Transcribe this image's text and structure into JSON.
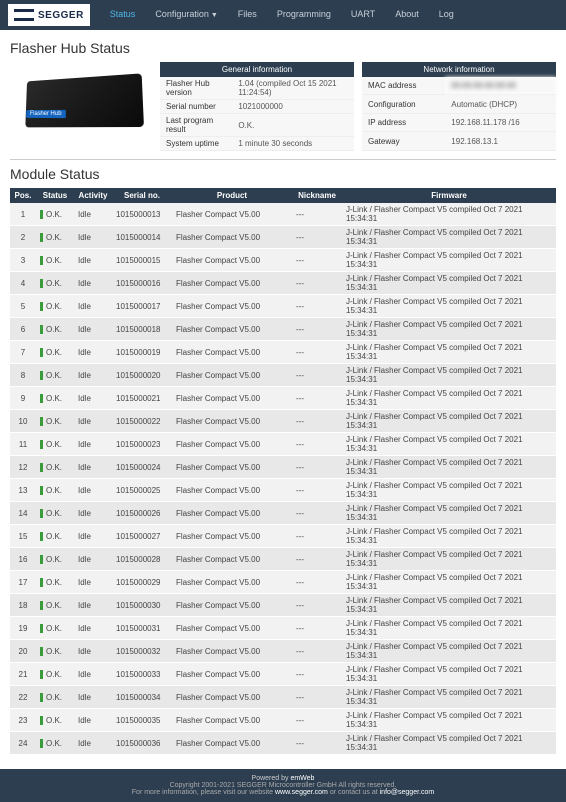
{
  "brand": "SEGGER",
  "nav": [
    "Status",
    "Configuration",
    "Files",
    "Programming",
    "UART",
    "About",
    "Log"
  ],
  "nav_active": 0,
  "nav_dropdown_index": 1,
  "hub_title": "Flasher Hub Status",
  "device_label": "Flasher Hub",
  "general": {
    "header": "General information",
    "rows": [
      {
        "k": "Flasher Hub version",
        "v": "1.04 (compiled Oct 15 2021 11:24:54)"
      },
      {
        "k": "Serial number",
        "v": "1021000000"
      },
      {
        "k": "Last program result",
        "v": "O.K."
      },
      {
        "k": "System uptime",
        "v": "1 minute 30 seconds"
      }
    ]
  },
  "network": {
    "header": "Network information",
    "rows": [
      {
        "k": "MAC address",
        "v": "",
        "blur": true
      },
      {
        "k": "Configuration",
        "v": "Automatic (DHCP)"
      },
      {
        "k": "IP address",
        "v": "192.168.11.178 /16"
      },
      {
        "k": "Gateway",
        "v": "192.168.13.1"
      }
    ]
  },
  "module_title": "Module Status",
  "mod_headers": [
    "Pos.",
    "Status",
    "Activity",
    "Serial no.",
    "Product",
    "Nickname",
    "Firmware"
  ],
  "modules": [
    {
      "pos": 1,
      "status": "O.K.",
      "activity": "Idle",
      "serial": "1015000013",
      "product": "Flasher Compact V5.00",
      "nick": "---",
      "fw": "J-Link / Flasher Compact V5 compiled Oct 7 2021 15:34:31"
    },
    {
      "pos": 2,
      "status": "O.K.",
      "activity": "Idle",
      "serial": "1015000014",
      "product": "Flasher Compact V5.00",
      "nick": "---",
      "fw": "J-Link / Flasher Compact V5 compiled Oct 7 2021 15:34:31"
    },
    {
      "pos": 3,
      "status": "O.K.",
      "activity": "Idle",
      "serial": "1015000015",
      "product": "Flasher Compact V5.00",
      "nick": "---",
      "fw": "J-Link / Flasher Compact V5 compiled Oct 7 2021 15:34:31"
    },
    {
      "pos": 4,
      "status": "O.K.",
      "activity": "Idle",
      "serial": "1015000016",
      "product": "Flasher Compact V5.00",
      "nick": "---",
      "fw": "J-Link / Flasher Compact V5 compiled Oct 7 2021 15:34:31"
    },
    {
      "pos": 5,
      "status": "O.K.",
      "activity": "Idle",
      "serial": "1015000017",
      "product": "Flasher Compact V5.00",
      "nick": "---",
      "fw": "J-Link / Flasher Compact V5 compiled Oct 7 2021 15:34:31"
    },
    {
      "pos": 6,
      "status": "O.K.",
      "activity": "Idle",
      "serial": "1015000018",
      "product": "Flasher Compact V5.00",
      "nick": "---",
      "fw": "J-Link / Flasher Compact V5 compiled Oct 7 2021 15:34:31"
    },
    {
      "pos": 7,
      "status": "O.K.",
      "activity": "Idle",
      "serial": "1015000019",
      "product": "Flasher Compact V5.00",
      "nick": "---",
      "fw": "J-Link / Flasher Compact V5 compiled Oct 7 2021 15:34:31"
    },
    {
      "pos": 8,
      "status": "O.K.",
      "activity": "Idle",
      "serial": "1015000020",
      "product": "Flasher Compact V5.00",
      "nick": "---",
      "fw": "J-Link / Flasher Compact V5 compiled Oct 7 2021 15:34:31"
    },
    {
      "pos": 9,
      "status": "O.K.",
      "activity": "Idle",
      "serial": "1015000021",
      "product": "Flasher Compact V5.00",
      "nick": "---",
      "fw": "J-Link / Flasher Compact V5 compiled Oct 7 2021 15:34:31"
    },
    {
      "pos": 10,
      "status": "O.K.",
      "activity": "Idle",
      "serial": "1015000022",
      "product": "Flasher Compact V5.00",
      "nick": "---",
      "fw": "J-Link / Flasher Compact V5 compiled Oct 7 2021 15:34:31"
    },
    {
      "pos": 11,
      "status": "O.K.",
      "activity": "Idle",
      "serial": "1015000023",
      "product": "Flasher Compact V5.00",
      "nick": "---",
      "fw": "J-Link / Flasher Compact V5 compiled Oct 7 2021 15:34:31"
    },
    {
      "pos": 12,
      "status": "O.K.",
      "activity": "Idle",
      "serial": "1015000024",
      "product": "Flasher Compact V5.00",
      "nick": "---",
      "fw": "J-Link / Flasher Compact V5 compiled Oct 7 2021 15:34:31"
    },
    {
      "pos": 13,
      "status": "O.K.",
      "activity": "Idle",
      "serial": "1015000025",
      "product": "Flasher Compact V5.00",
      "nick": "---",
      "fw": "J-Link / Flasher Compact V5 compiled Oct 7 2021 15:34:31"
    },
    {
      "pos": 14,
      "status": "O.K.",
      "activity": "Idle",
      "serial": "1015000026",
      "product": "Flasher Compact V5.00",
      "nick": "---",
      "fw": "J-Link / Flasher Compact V5 compiled Oct 7 2021 15:34:31"
    },
    {
      "pos": 15,
      "status": "O.K.",
      "activity": "Idle",
      "serial": "1015000027",
      "product": "Flasher Compact V5.00",
      "nick": "---",
      "fw": "J-Link / Flasher Compact V5 compiled Oct 7 2021 15:34:31"
    },
    {
      "pos": 16,
      "status": "O.K.",
      "activity": "Idle",
      "serial": "1015000028",
      "product": "Flasher Compact V5.00",
      "nick": "---",
      "fw": "J-Link / Flasher Compact V5 compiled Oct 7 2021 15:34:31"
    },
    {
      "pos": 17,
      "status": "O.K.",
      "activity": "Idle",
      "serial": "1015000029",
      "product": "Flasher Compact V5.00",
      "nick": "---",
      "fw": "J-Link / Flasher Compact V5 compiled Oct 7 2021 15:34:31"
    },
    {
      "pos": 18,
      "status": "O.K.",
      "activity": "Idle",
      "serial": "1015000030",
      "product": "Flasher Compact V5.00",
      "nick": "---",
      "fw": "J-Link / Flasher Compact V5 compiled Oct 7 2021 15:34:31"
    },
    {
      "pos": 19,
      "status": "O.K.",
      "activity": "Idle",
      "serial": "1015000031",
      "product": "Flasher Compact V5.00",
      "nick": "---",
      "fw": "J-Link / Flasher Compact V5 compiled Oct 7 2021 15:34:31"
    },
    {
      "pos": 20,
      "status": "O.K.",
      "activity": "Idle",
      "serial": "1015000032",
      "product": "Flasher Compact V5.00",
      "nick": "---",
      "fw": "J-Link / Flasher Compact V5 compiled Oct 7 2021 15:34:31"
    },
    {
      "pos": 21,
      "status": "O.K.",
      "activity": "Idle",
      "serial": "1015000033",
      "product": "Flasher Compact V5.00",
      "nick": "---",
      "fw": "J-Link / Flasher Compact V5 compiled Oct 7 2021 15:34:31"
    },
    {
      "pos": 22,
      "status": "O.K.",
      "activity": "Idle",
      "serial": "1015000034",
      "product": "Flasher Compact V5.00",
      "nick": "---",
      "fw": "J-Link / Flasher Compact V5 compiled Oct 7 2021 15:34:31"
    },
    {
      "pos": 23,
      "status": "O.K.",
      "activity": "Idle",
      "serial": "1015000035",
      "product": "Flasher Compact V5.00",
      "nick": "---",
      "fw": "J-Link / Flasher Compact V5 compiled Oct 7 2021 15:34:31"
    },
    {
      "pos": 24,
      "status": "O.K.",
      "activity": "Idle",
      "serial": "1015000036",
      "product": "Flasher Compact V5.00",
      "nick": "---",
      "fw": "J-Link / Flasher Compact V5 compiled Oct 7 2021 15:34:31"
    }
  ],
  "footer": {
    "powered_prefix": "Powered by ",
    "powered_link": "emWeb",
    "copyright": "Copyright 2001-2021 SEGGER Microcontroller GmbH All rights reserved.",
    "info_prefix": "For more information, please visit our website ",
    "site": "www.segger.com",
    "info_mid": " or contact us at ",
    "email": "info@segger.com"
  }
}
